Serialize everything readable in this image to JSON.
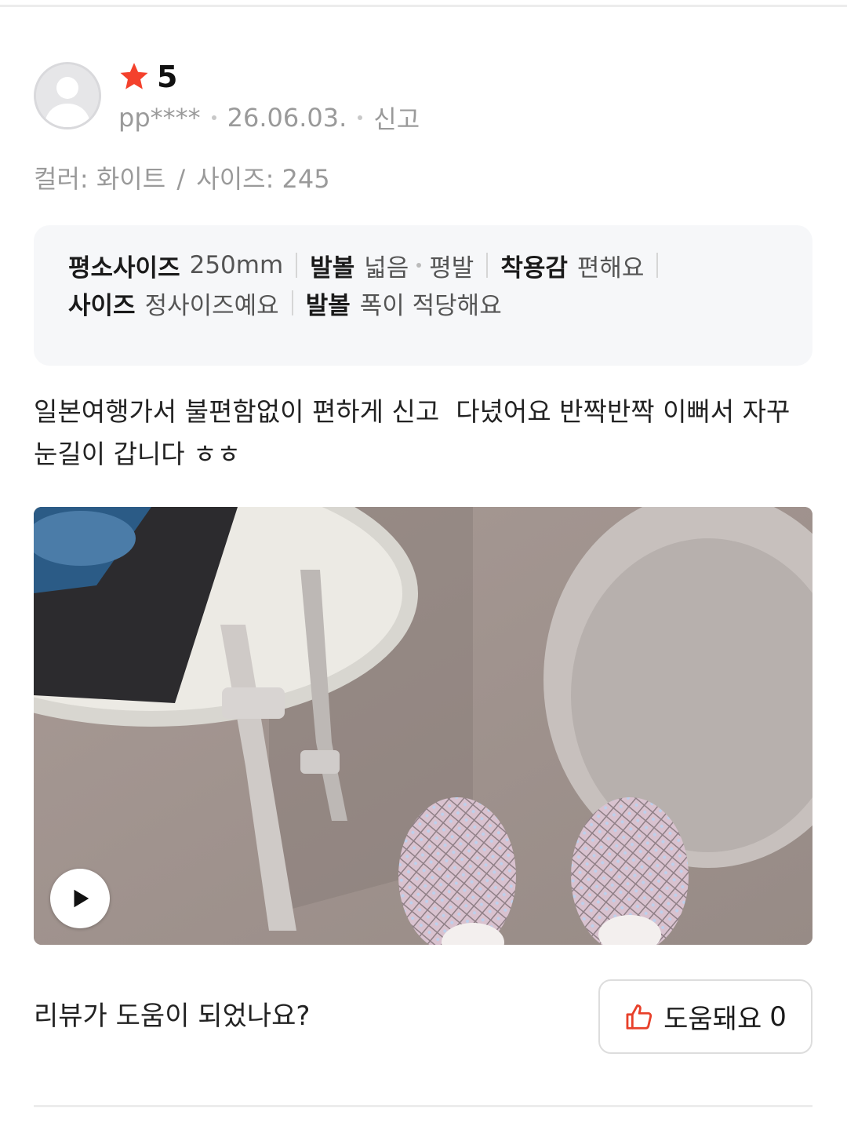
{
  "review": {
    "rating": "5",
    "user_id": "pp****",
    "date": "26.06.03.",
    "report_label": "신고",
    "option_color": "컬러: 화이트",
    "option_separator": "/",
    "option_size": "사이즈: 245",
    "fit_info": {
      "usual_size_label": "평소사이즈",
      "usual_size_value": "250mm",
      "foot_label": "발볼",
      "foot_value_1": "넓음",
      "foot_value_2": "평발",
      "comfort_label": "착용감",
      "comfort_value": "편해요",
      "size_label": "사이즈",
      "size_value": "정사이즈예요",
      "width_label": "발볼",
      "width_value": "폭이 적당해요"
    },
    "text": "일본여행가서 불편함없이 편하게 신고  다녔어요 반짝반짝 이뻐서 자꾸 눈길이 갑니다 ㅎㅎ",
    "media_type": "video"
  },
  "helpful": {
    "question": "리뷰가 도움이 되었나요?",
    "button_label": "도움돼요",
    "count": "0"
  },
  "colors": {
    "star": "#f4412c",
    "thumb": "#e8402a",
    "muted_text": "#9a9a9a",
    "info_bg": "#f6f7f9"
  },
  "icons": {
    "star": "star-icon",
    "play": "play-icon",
    "thumb": "thumbs-up-icon",
    "avatar": "user-avatar-icon"
  }
}
